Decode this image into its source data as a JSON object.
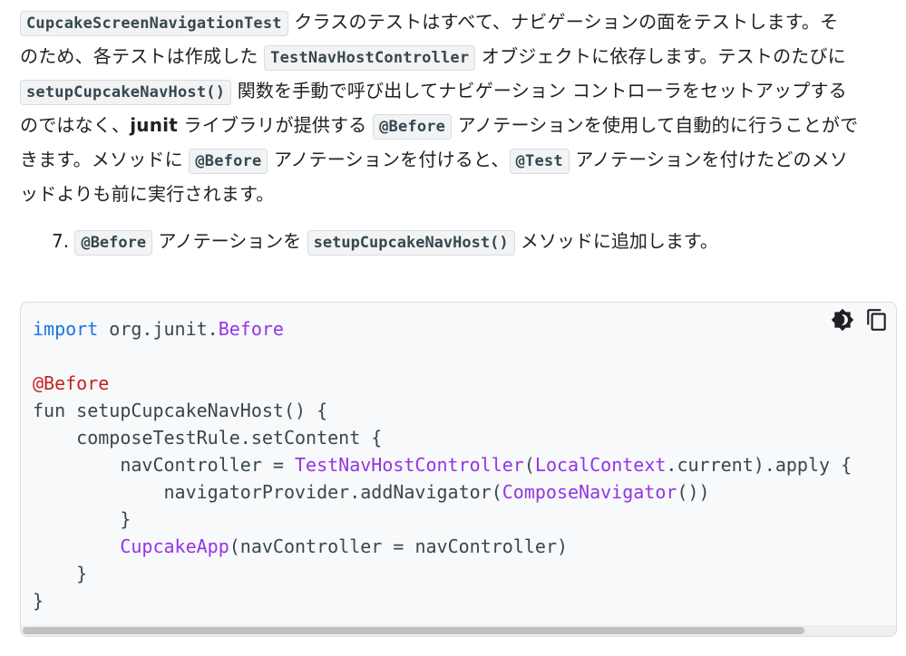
{
  "paragraph": {
    "l1_code1": "CupcakeScreenNavigationTest",
    "l1_t1": " クラスのテストはすべて、ナビゲーションの面をテストします。そ",
    "l2_t1": "のため、各テストは作成した ",
    "l2_code1": "TestNavHostController",
    "l2_t2": " オブジェクトに依存します。テストのたびに",
    "l3_code1": "setupCupcakeNavHost()",
    "l3_t1": " 関数を手動で呼び出してナビゲーション コントローラをセットアップする",
    "l4_t1": "のではなく、",
    "l4_bold": "junit",
    "l4_t2": " ライブラリが提供する ",
    "l4_code1": "@Before",
    "l4_t3": " アノテーションを使用して自動的に行うことがで",
    "l5_t1": "きます。メソッドに ",
    "l5_code1": "@Before",
    "l5_t2": " アノテーションを付けると、",
    "l5_code2": "@Test",
    "l5_t3": " アノテーションを付けたどのメソ",
    "l6_t1": "ッドよりも前に実行されます。"
  },
  "step": {
    "number": "7.",
    "code1": "@Before",
    "t1": " アノテーションを ",
    "code2": "setupCupcakeNavHost()",
    "t2": " メソッドに追加します。"
  },
  "code": {
    "l1_kw": "import",
    "l1_plain": " org.junit.",
    "l1_type": "Before",
    "l3_ann": "@Before",
    "l4": "fun setupCupcakeNavHost() {",
    "l5": "    composeTestRule.setContent {",
    "l6_a": "        navController = ",
    "l6_t1": "TestNavHostController",
    "l6_b": "(",
    "l6_t2": "LocalContext",
    "l6_c": ".current).apply {",
    "l7_a": "            navigatorProvider.addNavigator(",
    "l7_t1": "ComposeNavigator",
    "l7_b": "())",
    "l8": "        }",
    "l9_a": "        ",
    "l9_t1": "CupcakeApp",
    "l9_b": "(navController = navController)",
    "l10": "    }",
    "l11": "}"
  },
  "toolbar": {
    "theme_icon": "dark-mode-toggle-icon",
    "copy_icon": "content-copy-icon"
  },
  "colors": {
    "keyword": "#1a73e8",
    "type": "#9334e6",
    "annotation": "#c5221f",
    "code_bg": "#f8f9fa"
  }
}
